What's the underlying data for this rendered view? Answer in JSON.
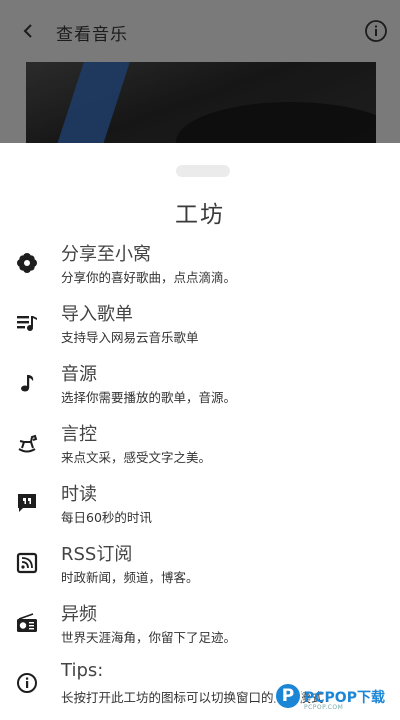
{
  "header": {
    "title": "查看音乐",
    "back_icon": "back-arrow-icon",
    "info_icon": "info-icon"
  },
  "sheet": {
    "title": "工坊",
    "items": [
      {
        "icon": "flower-share-icon",
        "name": "分享至小窝",
        "desc": "分享你的喜好歌曲，点点滴滴。"
      },
      {
        "icon": "playlist-import-icon",
        "name": "导入歌单",
        "desc": "支持导入网易云音乐歌单"
      },
      {
        "icon": "music-note-icon",
        "name": "音源",
        "desc": "选择你需要播放的歌单，音源。"
      },
      {
        "icon": "rocking-horse-icon",
        "name": "言控",
        "desc": "来点文采，感受文字之美。"
      },
      {
        "icon": "quote-chat-icon",
        "name": "时读",
        "desc": "每日60秒的时讯"
      },
      {
        "icon": "rss-feed-icon",
        "name": "RSS订阅",
        "desc": "时政新闻，频道，博客。"
      },
      {
        "icon": "radio-icon",
        "name": "异频",
        "desc": "世界天涯海角，你留下了足迹。"
      },
      {
        "icon": "info-circle-icon",
        "name": "Tips:",
        "desc": "长按打开此工坊的图标可以切换窗口的显示模式"
      }
    ]
  },
  "watermark": {
    "badge": "P",
    "text": "PCPOP下载",
    "sub": "PCPOP.COM"
  },
  "colors": {
    "backdrop": "#7a7a7a",
    "sheet": "#ffffff",
    "text": "#444444",
    "watermark": "#1c86d6"
  }
}
